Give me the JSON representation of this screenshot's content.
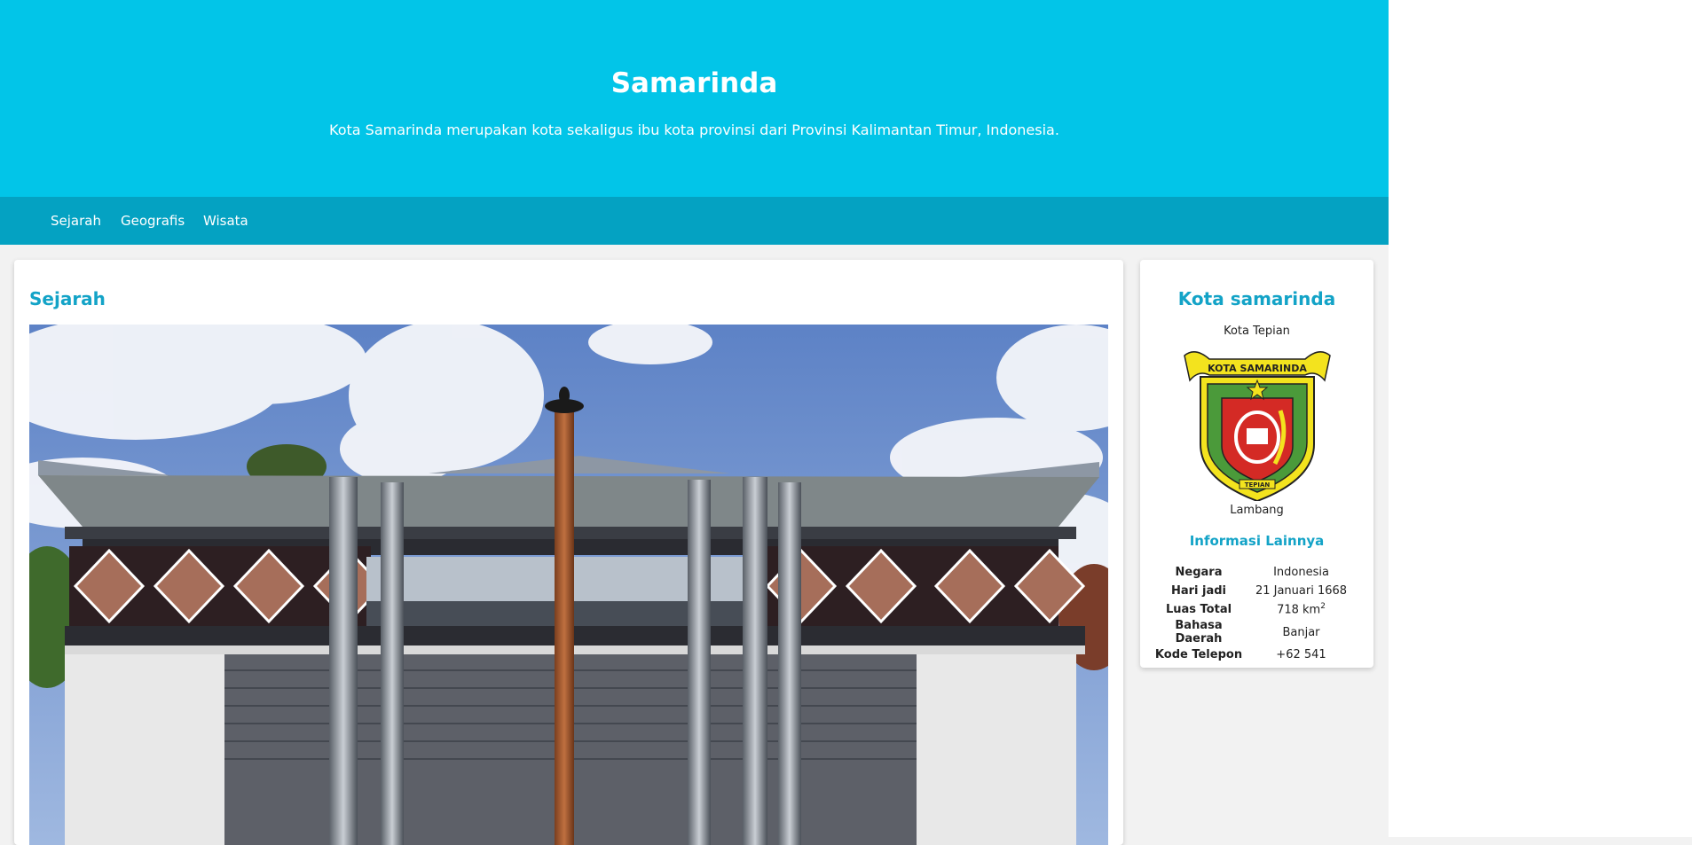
{
  "header": {
    "title": "Samarinda",
    "subtitle": "Kota Samarinda merupakan kota sekaligus ibu kota provinsi dari Provinsi Kalimantan Timur, Indonesia."
  },
  "nav": {
    "items": [
      {
        "label": "Sejarah"
      },
      {
        "label": "Geografis"
      },
      {
        "label": "Wisata"
      }
    ]
  },
  "main": {
    "section_title": "Sejarah",
    "image_icon": "building-photo"
  },
  "sidebar": {
    "title": "Kota samarinda",
    "nickname": "Kota Tepian",
    "emblem_caption": "Lambang",
    "emblem_banner_text": "KOTA SAMARINDA",
    "emblem_ribbon_text": "TEPIAN",
    "info_title": "Informasi Lainnya",
    "info": [
      {
        "key": "Negara",
        "value": "Indonesia"
      },
      {
        "key": "Hari jadi",
        "value": "21 Januari 1668"
      },
      {
        "key": "Luas Total",
        "value": "718 km",
        "sup": "2"
      },
      {
        "key": "Bahasa Daerah",
        "value": "Banjar"
      },
      {
        "key": "Kode Telepon",
        "value": "+62 541"
      }
    ]
  },
  "colors": {
    "hero_bg": "#02c5e8",
    "nav_bg": "#04a2c2",
    "accent": "#13a3c7"
  }
}
